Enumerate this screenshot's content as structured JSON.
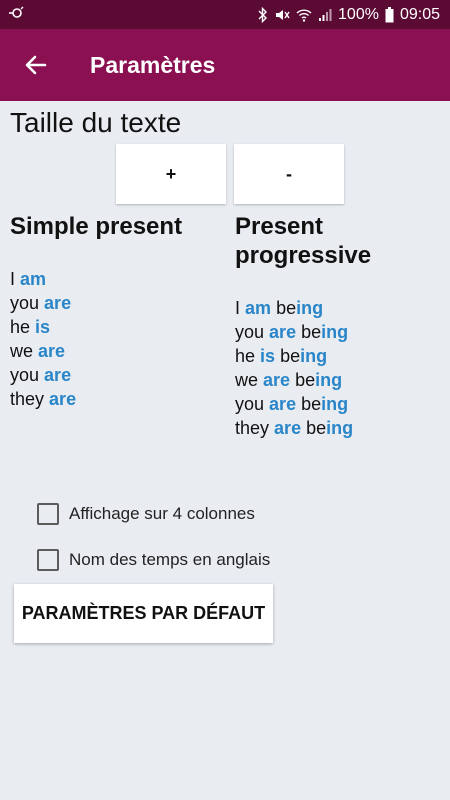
{
  "status_bar": {
    "battery": "100%",
    "time": "09:05",
    "icons": [
      "sync-icon",
      "bluetooth-icon",
      "mute-icon",
      "wifi-icon",
      "signal-icon",
      "battery-icon"
    ]
  },
  "app_bar": {
    "title": "Paramètres",
    "back_icon": "arrow-back-icon"
  },
  "text_size": {
    "label": "Taille du texte",
    "increase_label": "+",
    "decrease_label": "-"
  },
  "columns": [
    {
      "title": "Simple present",
      "rows": [
        {
          "pronoun": "I",
          "verb": "am",
          "suffix_plain": "",
          "suffix_hl": ""
        },
        {
          "pronoun": "you",
          "verb": "are",
          "suffix_plain": "",
          "suffix_hl": ""
        },
        {
          "pronoun": "he",
          "verb": "is",
          "suffix_plain": "",
          "suffix_hl": ""
        },
        {
          "pronoun": "we",
          "verb": "are",
          "suffix_plain": "",
          "suffix_hl": ""
        },
        {
          "pronoun": "you",
          "verb": "are",
          "suffix_plain": "",
          "suffix_hl": ""
        },
        {
          "pronoun": "they",
          "verb": "are",
          "suffix_plain": "",
          "suffix_hl": ""
        }
      ]
    },
    {
      "title": "Present progressive",
      "rows": [
        {
          "pronoun": "I",
          "verb": "am",
          "suffix_plain": "be",
          "suffix_hl": "ing"
        },
        {
          "pronoun": "you",
          "verb": "are",
          "suffix_plain": "be",
          "suffix_hl": "ing"
        },
        {
          "pronoun": "he",
          "verb": "is",
          "suffix_plain": "be",
          "suffix_hl": "ing"
        },
        {
          "pronoun": "we",
          "verb": "are",
          "suffix_plain": "be",
          "suffix_hl": "ing"
        },
        {
          "pronoun": "you",
          "verb": "are",
          "suffix_plain": "be",
          "suffix_hl": "ing"
        },
        {
          "pronoun": "they",
          "verb": "are",
          "suffix_plain": "be",
          "suffix_hl": "ing"
        }
      ]
    }
  ],
  "options": [
    {
      "label": "Affichage sur 4 colonnes",
      "checked": false
    },
    {
      "label": "Nom des temps en anglais",
      "checked": false
    }
  ],
  "defaults_button": {
    "label": "PARAMÈTRES PAR DÉFAUT"
  },
  "colors": {
    "status_bar": "#5a0a33",
    "app_bar": "#8a1052",
    "background": "#e9edf2",
    "highlight": "#2a86c8"
  }
}
